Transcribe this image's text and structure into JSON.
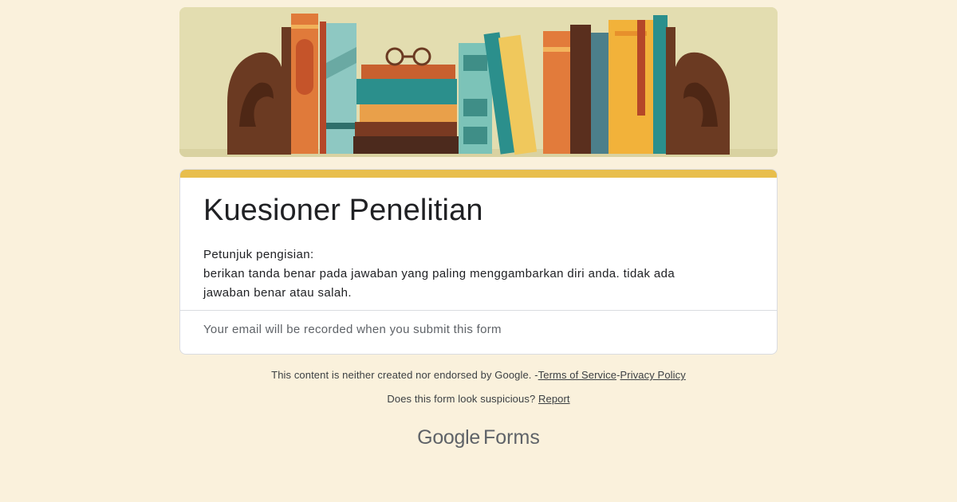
{
  "form": {
    "title": "Kuesioner Penelitian",
    "description_lines": [
      "Petunjuk pengisian:",
      "berikan tanda benar pada jawaban yang paling menggambarkan diri anda. tidak ada",
      "jawaban benar atau salah."
    ],
    "email_note": "Your email will be recorded when you submit this form",
    "accent_color": "#e8be4b",
    "background_color": "#faf1dc",
    "banner_theme": "bookshelf-illustration"
  },
  "footer": {
    "disclaimer": "This content is neither created nor endorsed by Google.",
    "separator": "-",
    "terms_label": "Terms of Service",
    "privacy_label": "Privacy Policy",
    "suspicious_text": "Does this form look suspicious?",
    "report_label": "Report",
    "brand_google": "Google",
    "brand_forms": "Forms"
  }
}
